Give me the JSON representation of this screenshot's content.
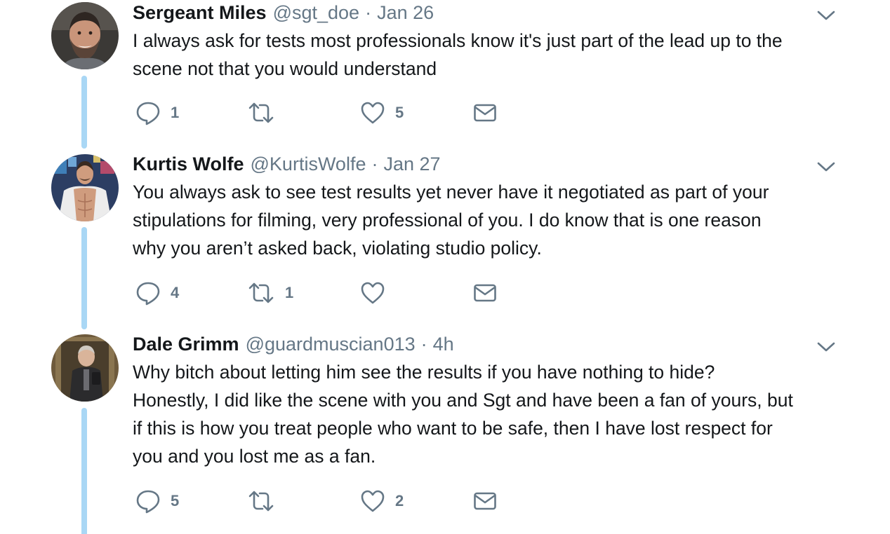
{
  "tweets": [
    {
      "name": "Sergeant Miles",
      "handle": "@sgt_doe",
      "separator": "·",
      "date": "Jan 26",
      "text": "I always ask for tests most professionals know it's just part of the lead up to the\nscene not that you would understand",
      "actions": {
        "reply": "1",
        "retweet": "",
        "like": "5"
      },
      "avatar_icon": "profile-photo-bearded-man"
    },
    {
      "name": "Kurtis Wolfe",
      "handle": "@KurtisWolfe",
      "separator": "·",
      "date": "Jan 27",
      "text": "You always ask to see test results yet never have it negotiated as part of your\nstipulations for filming, very professional of you. I do know that is one reason\nwhy you aren’t asked back, violating studio policy.",
      "actions": {
        "reply": "4",
        "retweet": "1",
        "like": ""
      },
      "avatar_icon": "profile-photo-shirtless-man"
    },
    {
      "name": "Dale Grimm",
      "handle": "@guardmuscian013",
      "separator": "·",
      "date": "4h",
      "text": "Why bitch about letting him see the results if you have nothing to hide?\nHonestly, I did like the scene with you and Sgt and have been a fan of yours, but\nif this is how you treat people who want to be safe, then I have lost respect for\nyou and you lost me as a fan.",
      "actions": {
        "reply": "5",
        "retweet": "",
        "like": "2"
      },
      "avatar_icon": "profile-photo-mirror-selfie"
    }
  ],
  "colors": {
    "text": "#14171a",
    "secondary": "#657786",
    "thread_line": "#a9d7f5"
  },
  "icons": [
    "reply-icon",
    "retweet-icon",
    "like-icon",
    "direct-message-icon",
    "chevron-down-icon"
  ]
}
